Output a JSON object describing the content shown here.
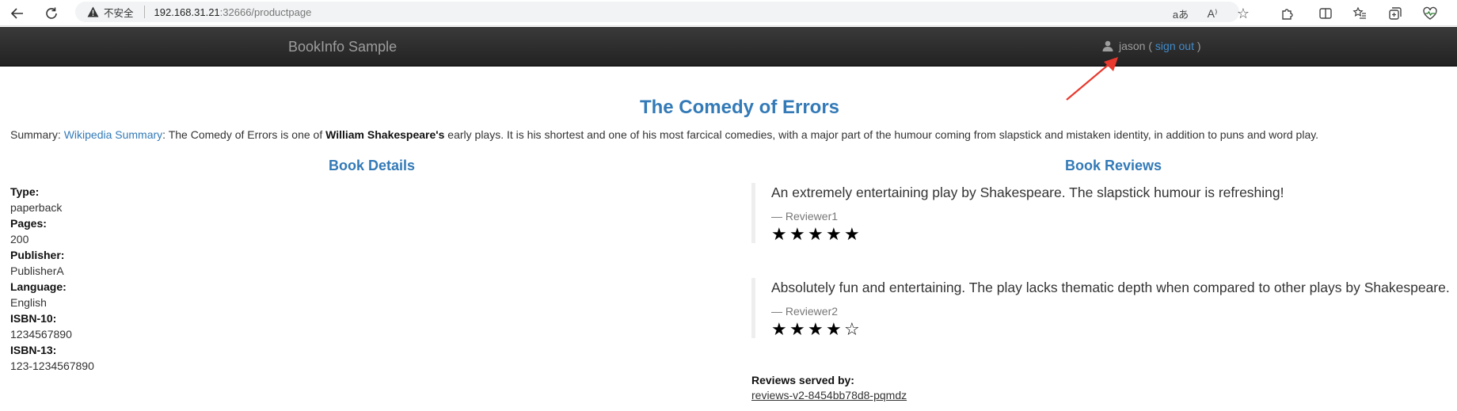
{
  "browser": {
    "insecure_label": "不安全",
    "url_host": "192.168.31.21",
    "url_path": ":32666/productpage"
  },
  "navbar": {
    "brand": "BookInfo Sample",
    "username": "jason",
    "open_paren": " ( ",
    "sign_out": "sign out",
    "close_paren": " )"
  },
  "product": {
    "title": "The Comedy of Errors",
    "summary_label": "Summary: ",
    "summary_link": "Wikipedia Summary",
    "summary_text_1": ": The Comedy of Errors is one of ",
    "summary_bold": "William Shakespeare's",
    "summary_text_2": " early plays. It is his shortest and one of his most farcical comedies, with a major part of the humour coming from slapstick and mistaken identity, in addition to puns and word play."
  },
  "details": {
    "heading": "Book Details",
    "items": [
      {
        "label": "Type:",
        "value": "paperback"
      },
      {
        "label": "Pages:",
        "value": "200"
      },
      {
        "label": "Publisher:",
        "value": "PublisherA"
      },
      {
        "label": "Language:",
        "value": "English"
      },
      {
        "label": "ISBN-10:",
        "value": "1234567890"
      },
      {
        "label": "ISBN-13:",
        "value": "123-1234567890"
      }
    ]
  },
  "reviews": {
    "heading": "Book Reviews",
    "items": [
      {
        "text": "An extremely entertaining play by Shakespeare. The slapstick humour is refreshing!",
        "reviewer": "— Reviewer1",
        "rating": 5,
        "max": 5
      },
      {
        "text": "Absolutely fun and entertaining. The play lacks thematic depth when compared to other plays by Shakespeare.",
        "reviewer": "— Reviewer2",
        "rating": 4,
        "max": 5
      }
    ],
    "served_by_label": "Reviews served by:",
    "served_by_pod": "reviews-v2-8454bb78d8-pqmdz"
  },
  "colors": {
    "link": "#337ab7",
    "navbar": "#222222",
    "annotation_arrow": "#e8392e"
  }
}
